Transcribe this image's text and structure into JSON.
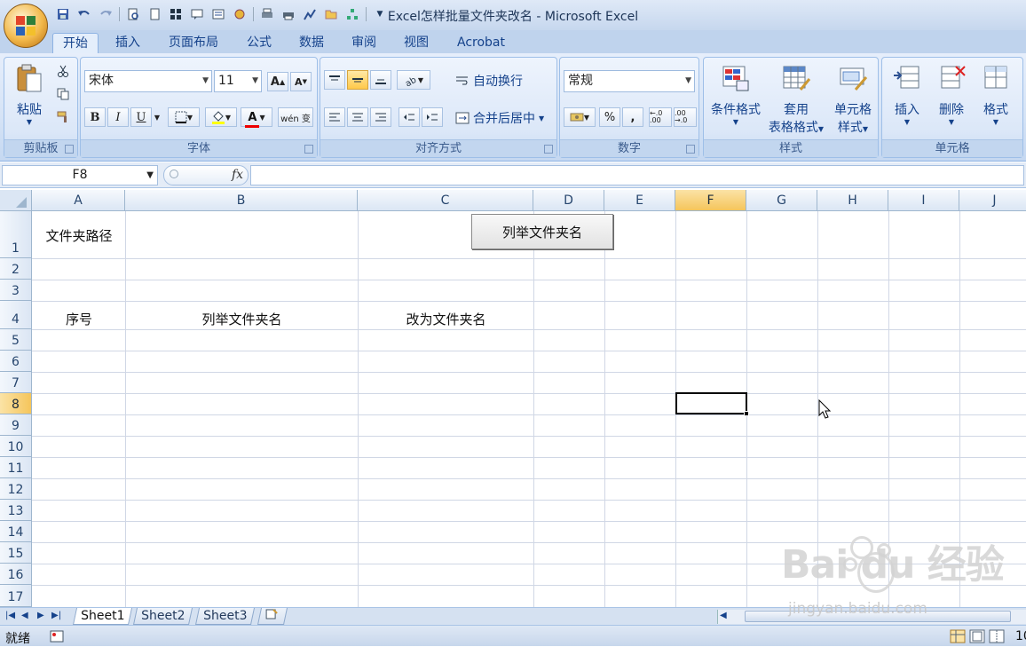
{
  "window": {
    "title": "Excel怎样批量文件夹改名 - Microsoft Excel"
  },
  "tabs": [
    {
      "label": "开始",
      "active": true
    },
    {
      "label": "插入"
    },
    {
      "label": "页面布局"
    },
    {
      "label": "公式"
    },
    {
      "label": "数据"
    },
    {
      "label": "审阅"
    },
    {
      "label": "视图"
    },
    {
      "label": "Acrobat"
    }
  ],
  "ribbon": {
    "clipboard": {
      "label": "剪贴板",
      "paste": "粘贴"
    },
    "font": {
      "label": "字体",
      "name": "宋体",
      "size": "11",
      "bold": "B",
      "italic": "I",
      "underline": "U",
      "font_color_glyph": "A",
      "wen": "wén 变"
    },
    "alignment": {
      "label": "对齐方式",
      "wrap": "自动换行",
      "merge": "合并后居中"
    },
    "number": {
      "label": "数字",
      "format": "常规",
      "percent": "%",
      "comma": ",",
      "inc_decimal": "←.0 .00",
      "dec_decimal": ".00 →.0"
    },
    "styles": {
      "label": "样式",
      "conditional": "条件格式",
      "table_l1": "套用",
      "table_l2": "表格格式",
      "cell_l1": "单元格",
      "cell_l2": "样式"
    },
    "cells": {
      "label": "单元格",
      "insert": "插入",
      "delete": "删除",
      "format": "格式"
    }
  },
  "formula_bar": {
    "name_box": "F8",
    "fx": "fx",
    "value": ""
  },
  "columns": [
    "A",
    "B",
    "C",
    "D",
    "E",
    "F",
    "G",
    "H",
    "I",
    "J"
  ],
  "selected_column": "F",
  "rows": [
    "1",
    "2",
    "3",
    "4",
    "5",
    "6",
    "7",
    "8",
    "9",
    "10",
    "11",
    "12",
    "13",
    "14",
    "15",
    "16",
    "17"
  ],
  "selected_row": "8",
  "cells": {
    "A1": "文件夹路径",
    "A4": "序号",
    "B4": "列举文件夹名",
    "C4": "改为文件夹名"
  },
  "macro_button": "列举文件夹名",
  "sheets": [
    {
      "name": "Sheet1",
      "active": true
    },
    {
      "name": "Sheet2"
    },
    {
      "name": "Sheet3"
    }
  ],
  "status": {
    "text": "就绪",
    "zoom_partial": "10"
  },
  "watermark": {
    "brand": "Bai du 经验",
    "url": "jingyan.baidu.com"
  },
  "colors": {
    "accent": "#15428b",
    "selected_header": "#f5c55b",
    "ribbon_bg": "#dbe7f8"
  }
}
